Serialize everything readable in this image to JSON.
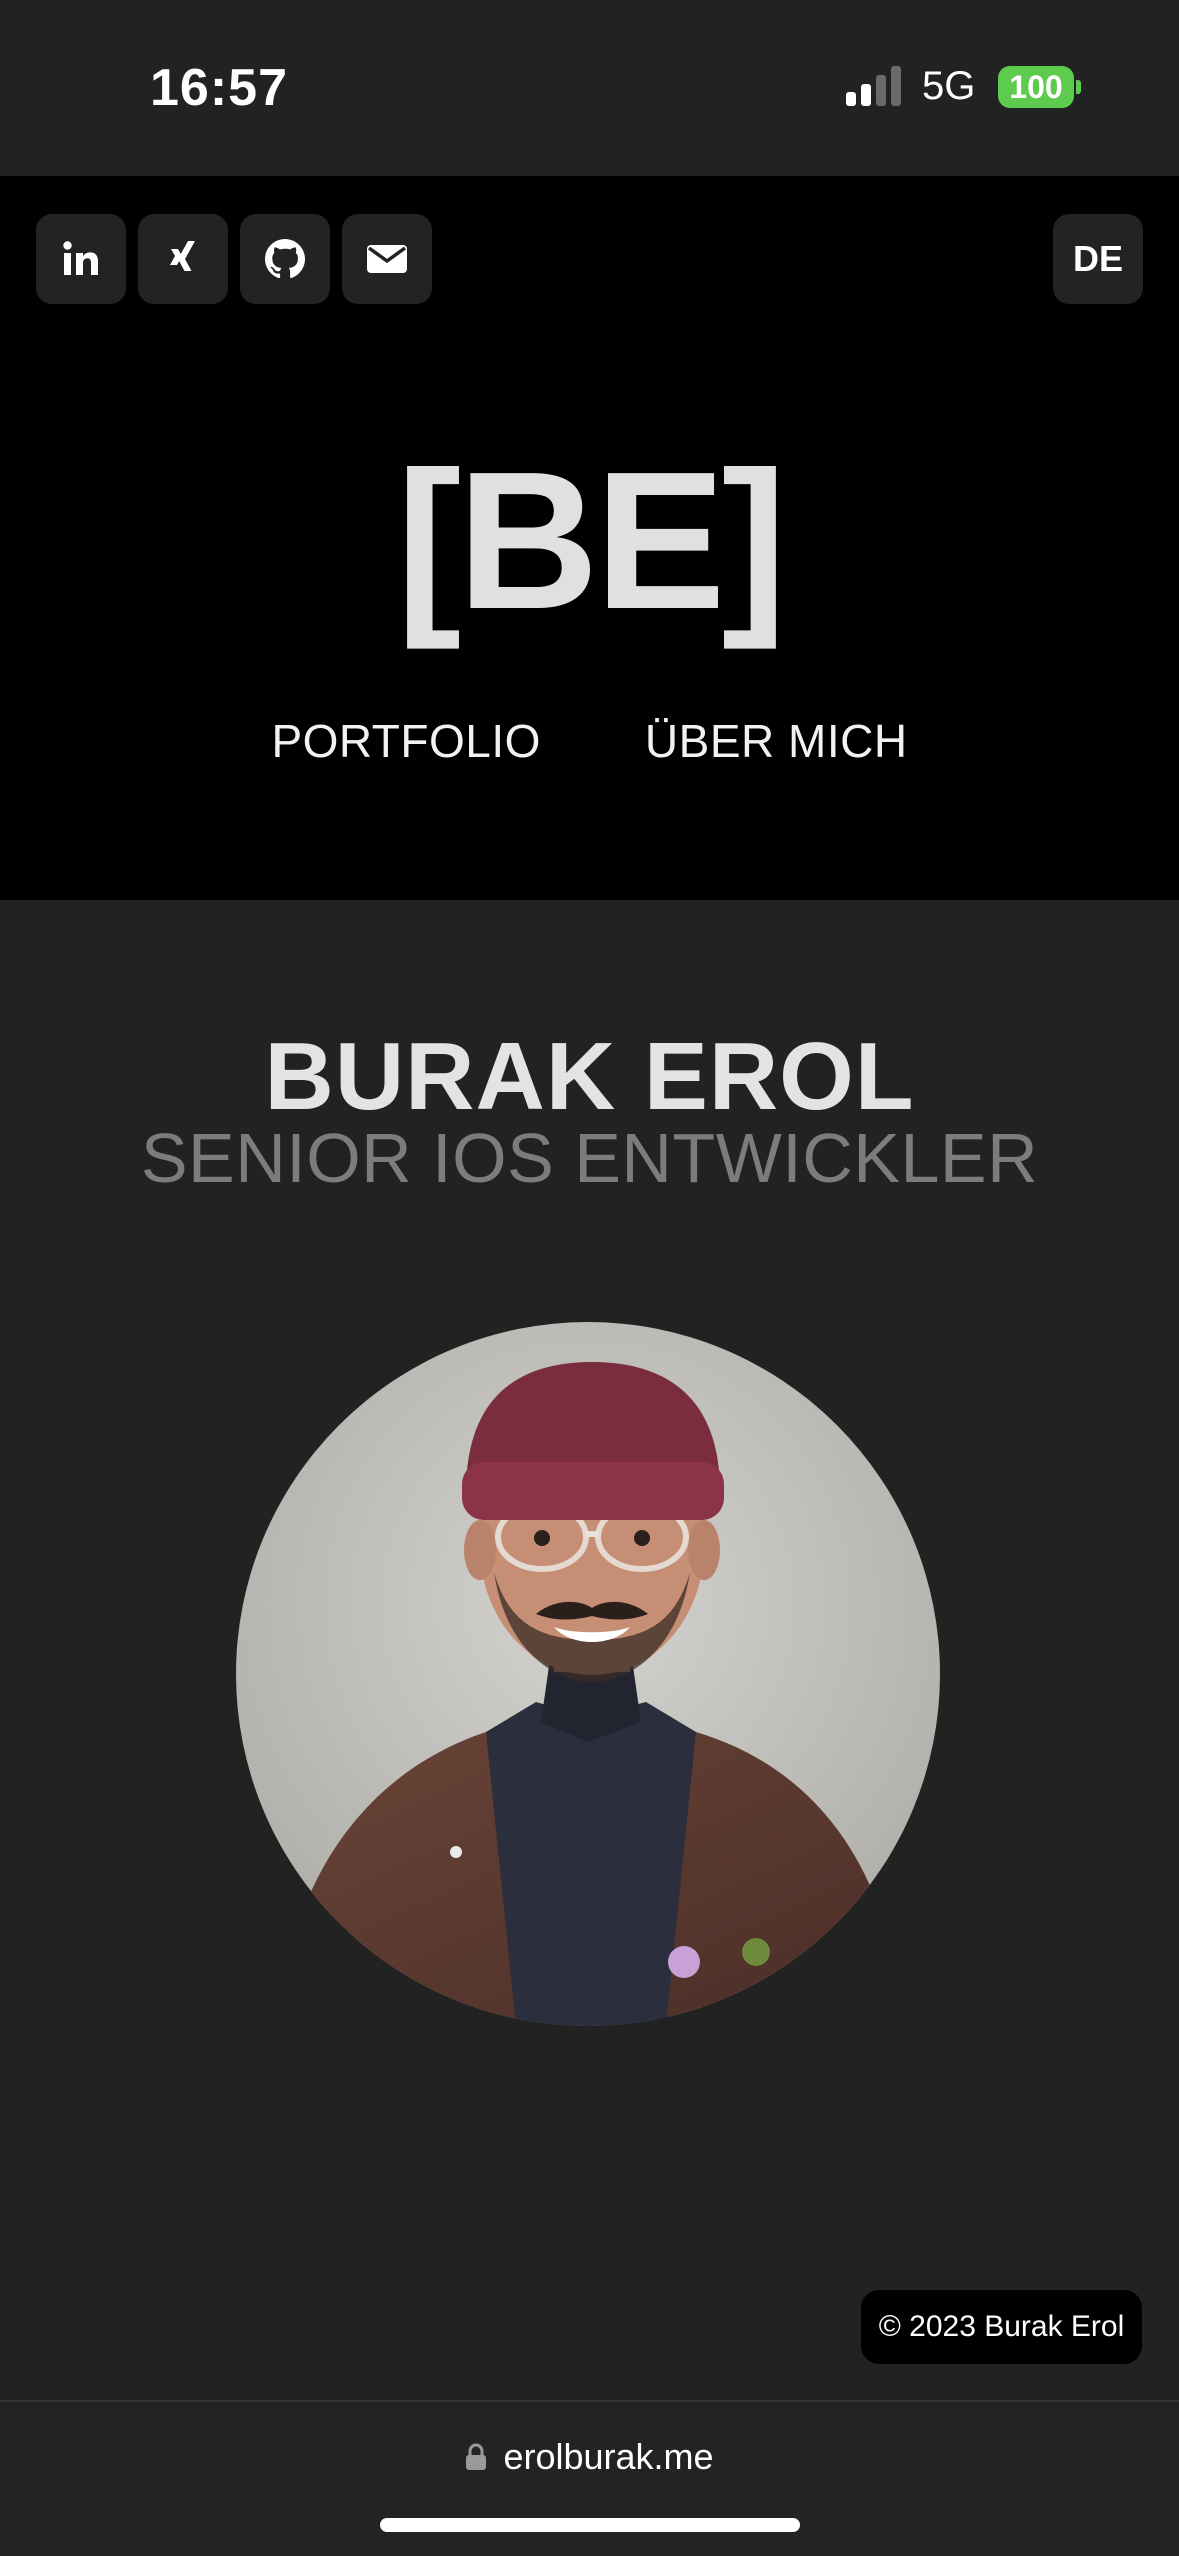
{
  "status_bar": {
    "time": "16:57",
    "network": "5G",
    "battery": "100",
    "icons": [
      "signal-icon",
      "battery-icon"
    ]
  },
  "header": {
    "social_links": [
      {
        "name": "linkedin",
        "icon": "linkedin-icon"
      },
      {
        "name": "xing",
        "icon": "xing-icon"
      },
      {
        "name": "github",
        "icon": "github-icon"
      },
      {
        "name": "email",
        "icon": "mail-icon"
      }
    ],
    "language": "DE",
    "logo": "[BE]",
    "nav": [
      "PORTFOLIO",
      "ÜBER MICH"
    ]
  },
  "main": {
    "name": "BURAK EROL",
    "role": "SENIOR IOS ENTWICKLER",
    "avatar": "profile-photo"
  },
  "footer": {
    "copyright": "© 2023 Burak Erol"
  },
  "browser": {
    "url": "erolburak.me",
    "icon": "lock-icon"
  },
  "colors": {
    "background": "#222223",
    "header_background": "#000000",
    "button_background": "#232324",
    "subtitle": "#7c7c7c",
    "battery": "#5ccb4e"
  }
}
